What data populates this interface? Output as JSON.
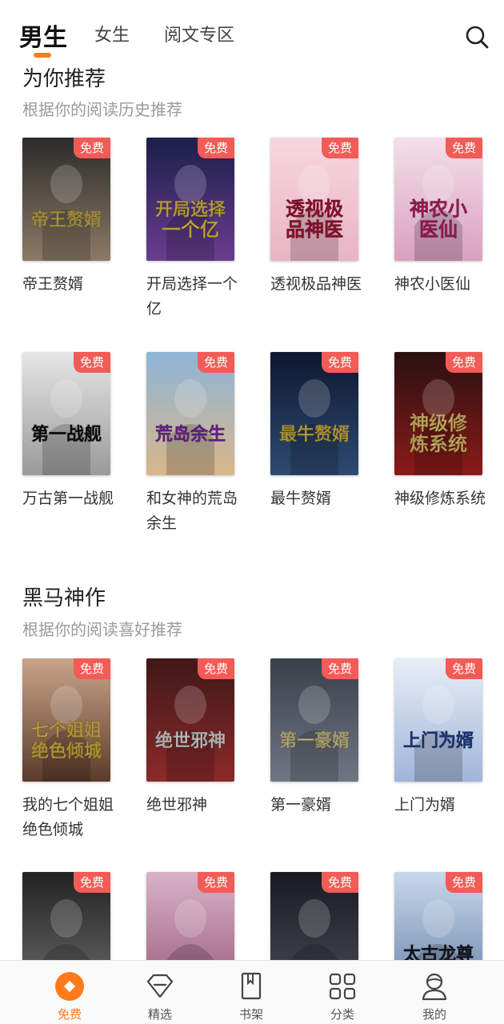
{
  "tabs": [
    {
      "label": "男生",
      "active": true
    },
    {
      "label": "女生",
      "active": false
    },
    {
      "label": "阅文专区",
      "active": false
    }
  ],
  "colors": {
    "accent": "#ff7a1a",
    "badge": "#f35b56"
  },
  "sections": [
    {
      "title": "为你推荐",
      "subtitle": "根据你的阅读历史推荐",
      "books": [
        {
          "title": "帝王赘婿",
          "cover_text": "帝王赘婿",
          "badge": "免费"
        },
        {
          "title": "开局选择一个亿",
          "cover_text": "开局选择一个亿",
          "badge": "免费"
        },
        {
          "title": "透视极品神医",
          "cover_text": "透视极品神医",
          "badge": "免费"
        },
        {
          "title": "神农小医仙",
          "cover_text": "神农小医仙",
          "badge": "免费"
        },
        {
          "title": "万古第一战舰",
          "cover_text": "第一战舰",
          "badge": "免费"
        },
        {
          "title": "和女神的荒岛余生",
          "cover_text": "荒岛余生",
          "badge": "免费"
        },
        {
          "title": "最牛赘婿",
          "cover_text": "最牛赘婿",
          "badge": "免费"
        },
        {
          "title": "神级修炼系统",
          "cover_text": "神级修炼系统",
          "badge": "免费"
        }
      ]
    },
    {
      "title": "黑马神作",
      "subtitle": "根据你的阅读喜好推荐",
      "books": [
        {
          "title": "我的七个姐姐绝色倾城",
          "cover_text": "七个姐姐绝色倾城",
          "badge": "免费"
        },
        {
          "title": "绝世邪神",
          "cover_text": "绝世邪神",
          "badge": "免费"
        },
        {
          "title": "第一豪婿",
          "cover_text": "第一豪婿",
          "badge": "免费"
        },
        {
          "title": "上门为婿",
          "cover_text": "上门为婿",
          "badge": "免费"
        },
        {
          "title": "",
          "cover_text": "",
          "badge": "免费"
        },
        {
          "title": "",
          "cover_text": "",
          "badge": "免费"
        },
        {
          "title": "",
          "cover_text": "",
          "badge": "免费"
        },
        {
          "title": "",
          "cover_text": "太古龙尊",
          "badge": "免费"
        }
      ]
    }
  ],
  "bottom_nav": [
    {
      "label": "免费",
      "icon": "free-icon",
      "active": true
    },
    {
      "label": "精选",
      "icon": "diamond-icon",
      "active": false
    },
    {
      "label": "书架",
      "icon": "bookshelf-icon",
      "active": false
    },
    {
      "label": "分类",
      "icon": "category-icon",
      "active": false
    },
    {
      "label": "我的",
      "icon": "profile-icon",
      "active": false
    }
  ]
}
